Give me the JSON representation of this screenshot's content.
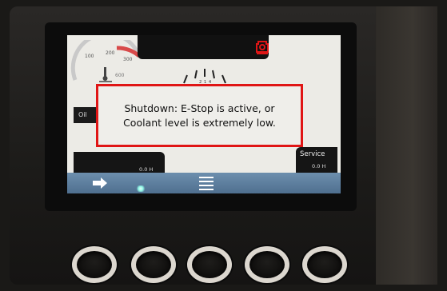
{
  "top_bar": {
    "alarm_icon": "engine-alarm-icon",
    "alarm_color": "#e01515"
  },
  "gauge": {
    "ticks": [
      "100",
      "200",
      "300"
    ],
    "max": "600"
  },
  "center_gauge": {
    "ticks": [
      "2",
      "1",
      "4"
    ]
  },
  "left_label": "Oil",
  "dialog": {
    "line1": "Shutdown: E-Stop is active, or",
    "line2": "Coolant level is extremely low.",
    "border_color": "#e01515"
  },
  "left_panel": {
    "value": "0.0 H"
  },
  "right_panel": {
    "label": "Service",
    "value": "0.0 H"
  },
  "nav_bar": {
    "left_icon": "arrow-right-icon",
    "center_icon": "menu-icon",
    "indicator_icon": "status-led-icon",
    "color": "#5b7c9c"
  },
  "hardware_buttons": [
    {
      "name": "softkey-1"
    },
    {
      "name": "softkey-2"
    },
    {
      "name": "softkey-3"
    },
    {
      "name": "softkey-4"
    },
    {
      "name": "softkey-5"
    }
  ]
}
